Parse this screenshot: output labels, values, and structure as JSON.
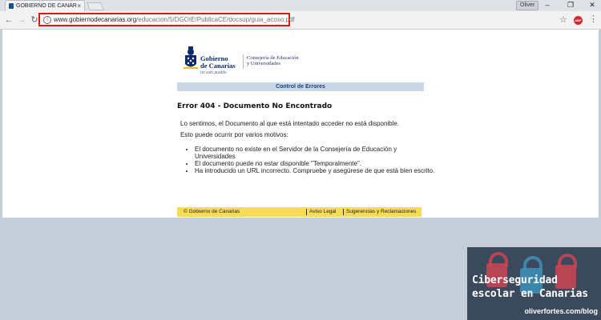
{
  "browser": {
    "tab_title": "GOBIERNO DE CANARIAS",
    "tab_close": "×",
    "user_name": "Oliver",
    "window_minimize": "–",
    "window_maximize": "❐",
    "window_close": "✕",
    "nav_back": "←",
    "nav_forward": "→",
    "nav_reload": "↻",
    "url_host": "www.gobiernodecanarias.org",
    "url_path": "/educacion/5/DGOIE/PublicaCE/docsup/guia_acoso.pdf",
    "url_highlight_color": "#e0151b",
    "star": "☆",
    "ext_label": "ABP",
    "menu": "⋮"
  },
  "page": {
    "brand_line1": "Gobierno",
    "brand_line2": "de Canarias",
    "brand_tagline": "un solo pueblo",
    "dept_line1": "Consejería de Educación",
    "dept_line2": "y Universidades",
    "error_bar": "Control de Errores",
    "error_title": "Error 404 - Documento No Encontrado",
    "message1": "Lo sentimos, el Documento al que está intentado acceder no está disponible.",
    "message2": "Esto puede ocurrir por varios motivos:",
    "reasons": [
      "El documento no existe en el Servidor de la Consejería de Educación y Universidades",
      "El documento puede no estar disponible \"Temporalmente\".",
      "Ha introducido un URL incorrecto. Compruebe y asegúrese de que está bien escrito."
    ],
    "footer_copy": "© Gobierno de Canarias",
    "footer_legal": "Aviso Legal",
    "footer_suggestions": "Sugerencias y Reclamaciones",
    "brand_color": "#0d2b6b",
    "footer_color": "#f8dd53"
  },
  "watermark": {
    "title1": "Ciberseguridad",
    "title2": "escolar en Canarias",
    "site": "oliverfortes.com/blog"
  }
}
